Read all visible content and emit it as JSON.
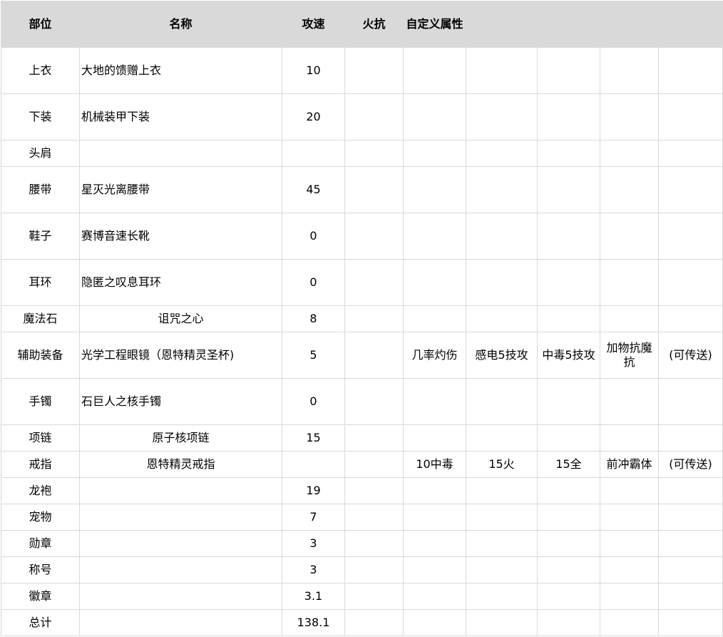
{
  "headers": [
    "部位",
    "名称",
    "攻速",
    "火抗",
    "自定义属性",
    "",
    "",
    "",
    ""
  ],
  "rows": [
    {
      "part": "上衣",
      "name": "大地的馈赠上衣",
      "speed": "10",
      "fire": "",
      "c1": "",
      "c2": "",
      "c3": "",
      "c4": "",
      "c5": ""
    },
    {
      "part": "下装",
      "name": "机械装甲下装",
      "speed": "20",
      "fire": "",
      "c1": "",
      "c2": "",
      "c3": "",
      "c4": "",
      "c5": ""
    },
    {
      "part": "头肩",
      "name": "",
      "speed": "",
      "fire": "",
      "c1": "",
      "c2": "",
      "c3": "",
      "c4": "",
      "c5": ""
    },
    {
      "part": "腰带",
      "name": "星灭光离腰带",
      "speed": "45",
      "fire": "",
      "c1": "",
      "c2": "",
      "c3": "",
      "c4": "",
      "c5": ""
    },
    {
      "part": "鞋子",
      "name": "赛博音速长靴",
      "speed": "0",
      "fire": "",
      "c1": "",
      "c2": "",
      "c3": "",
      "c4": "",
      "c5": ""
    },
    {
      "part": "耳环",
      "name": "隐匿之叹息耳环",
      "speed": "0",
      "fire": "",
      "c1": "",
      "c2": "",
      "c3": "",
      "c4": "",
      "c5": ""
    },
    {
      "part": "魔法石",
      "name": "诅咒之心",
      "speed": "8",
      "fire": "",
      "c1": "",
      "c2": "",
      "c3": "",
      "c4": "",
      "c5": ""
    },
    {
      "part": "辅助装备",
      "name": "光学工程眼镜（恩特精灵圣杯)",
      "speed": "5",
      "fire": "",
      "c1": "几率灼伤",
      "c2": "感电5技攻",
      "c3": "中毒5技攻",
      "c4": "加物抗魔抗",
      "c5": "(可传送)"
    },
    {
      "part": "手镯",
      "name": "石巨人之核手镯",
      "speed": "0",
      "fire": "",
      "c1": "",
      "c2": "",
      "c3": "",
      "c4": "",
      "c5": ""
    },
    {
      "part": "项链",
      "name": "原子核项链",
      "speed": "15",
      "fire": "",
      "c1": "",
      "c2": "",
      "c3": "",
      "c4": "",
      "c5": ""
    },
    {
      "part": "戒指",
      "name": "恩特精灵戒指",
      "speed": "",
      "fire": "",
      "c1": "10中毒",
      "c2": "15火",
      "c3": "15全",
      "c4": "前冲霸体",
      "c5": "(可传送)"
    },
    {
      "part": "龙袍",
      "name": "",
      "speed": "19",
      "fire": "",
      "c1": "",
      "c2": "",
      "c3": "",
      "c4": "",
      "c5": ""
    },
    {
      "part": "宠物",
      "name": "",
      "speed": "7",
      "fire": "",
      "c1": "",
      "c2": "",
      "c3": "",
      "c4": "",
      "c5": ""
    },
    {
      "part": "勋章",
      "name": "",
      "speed": "3",
      "fire": "",
      "c1": "",
      "c2": "",
      "c3": "",
      "c4": "",
      "c5": ""
    },
    {
      "part": "称号",
      "name": "",
      "speed": "3",
      "fire": "",
      "c1": "",
      "c2": "",
      "c3": "",
      "c4": "",
      "c5": ""
    },
    {
      "part": "徽章",
      "name": "",
      "speed": "3.1",
      "fire": "",
      "c1": "",
      "c2": "",
      "c3": "",
      "c4": "",
      "c5": ""
    },
    {
      "part": "总计",
      "name": "",
      "speed": "138.1",
      "fire": "",
      "c1": "",
      "c2": "",
      "c3": "",
      "c4": "",
      "c5": ""
    }
  ]
}
